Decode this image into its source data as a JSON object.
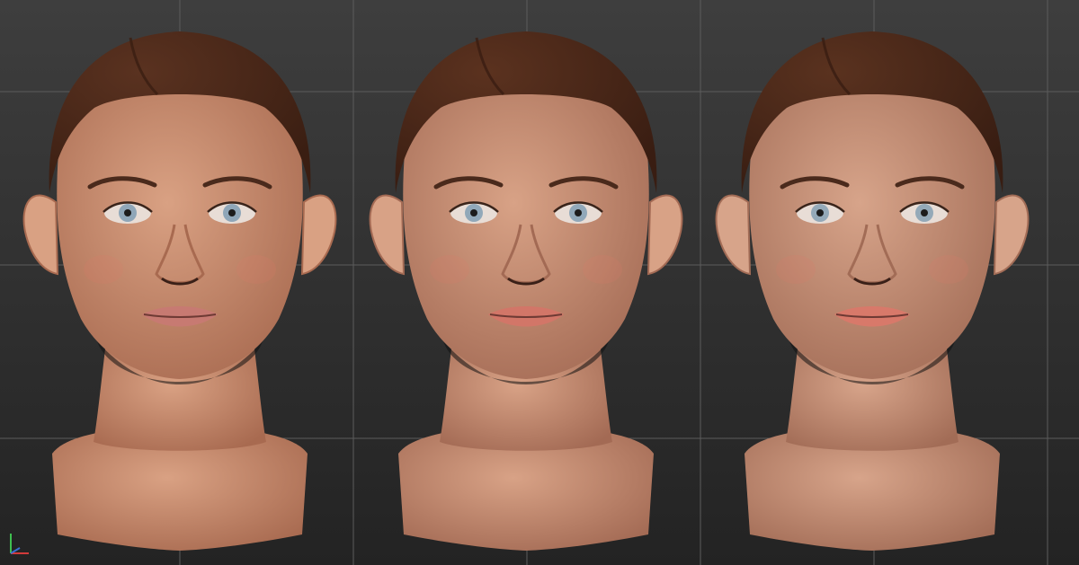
{
  "viewport": {
    "background_top": "#3e3e3e",
    "background_bottom": "#232323",
    "grid_color": "#5c5c5c"
  },
  "heads": [
    {
      "skin": "#d9a183",
      "skin_shadow": "#a86a50",
      "hair": "#3a1e12",
      "hair_highlight": "#5a3220",
      "lips": "#c77a72",
      "iris": "#8fa6b8"
    },
    {
      "skin": "#d8a286",
      "skin_shadow": "#a36a54",
      "hair": "#391d12",
      "hair_highlight": "#5b321f",
      "lips": "#d27668",
      "iris": "#91a8b9"
    },
    {
      "skin": "#d7a48a",
      "skin_shadow": "#a26c56",
      "hair": "#381d12",
      "hair_highlight": "#5a321f",
      "lips": "#d8796a",
      "iris": "#94a9b8"
    }
  ],
  "gizmo": {
    "x_color": "#d23b3b",
    "y_color": "#3b6fd2",
    "z_color": "#3fbf4f"
  }
}
